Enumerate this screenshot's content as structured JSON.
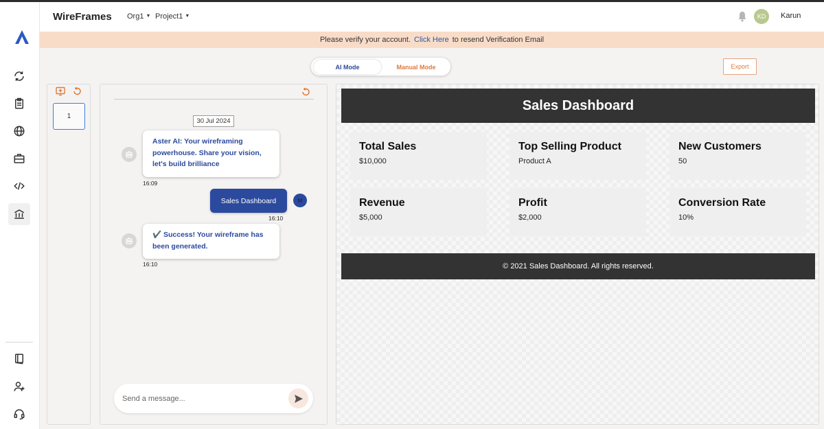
{
  "header": {
    "app_title": "WireFrames",
    "org": "Org1",
    "project": "Project1",
    "avatar_initials": "KD",
    "user_name": "Karun"
  },
  "banner": {
    "text_before": "Please verify your account.",
    "link": "Click Here",
    "text_after": "to resend Verification Email"
  },
  "mode_toggle": {
    "ai_label": "AI Mode",
    "manual_label": "Manual Mode",
    "selected": "AI Mode"
  },
  "export_label": "Export",
  "pages": {
    "current_page": "1"
  },
  "chat": {
    "date": "30 Jul 2024",
    "messages": [
      {
        "from": "bot",
        "text": "Aster AI: Your wireframing powerhouse. Share your vision, let's build brilliance",
        "time": "16:09"
      },
      {
        "from": "user",
        "text": "Sales Dashboard",
        "time": "16:10",
        "avatar_letter": "M"
      },
      {
        "from": "bot",
        "text": "✔️ Success! Your wireframe has been generated.",
        "time": "16:10"
      }
    ],
    "input_placeholder": "Send a message..."
  },
  "preview": {
    "title": "Sales Dashboard",
    "cards": [
      {
        "title": "Total Sales",
        "value": "$10,000"
      },
      {
        "title": "Top Selling Product",
        "value": "Product A"
      },
      {
        "title": "New Customers",
        "value": "50"
      },
      {
        "title": "Revenue",
        "value": "$5,000"
      },
      {
        "title": "Profit",
        "value": "$2,000"
      },
      {
        "title": "Conversion Rate",
        "value": "10%"
      }
    ],
    "footer": "© 2021 Sales Dashboard. All rights reserved."
  },
  "colors": {
    "brand_blue": "#2b4a9e",
    "accent_orange": "#e07a3a",
    "banner_bg": "#f9dcc8",
    "dark_header": "#333333"
  },
  "icons": {
    "sidebar": [
      "logo-icon",
      "refresh-icon",
      "clipboard-icon",
      "globe-icon",
      "briefcase-icon",
      "code-icon",
      "bank-icon",
      "book-icon",
      "add-user-icon",
      "headset-icon"
    ]
  }
}
